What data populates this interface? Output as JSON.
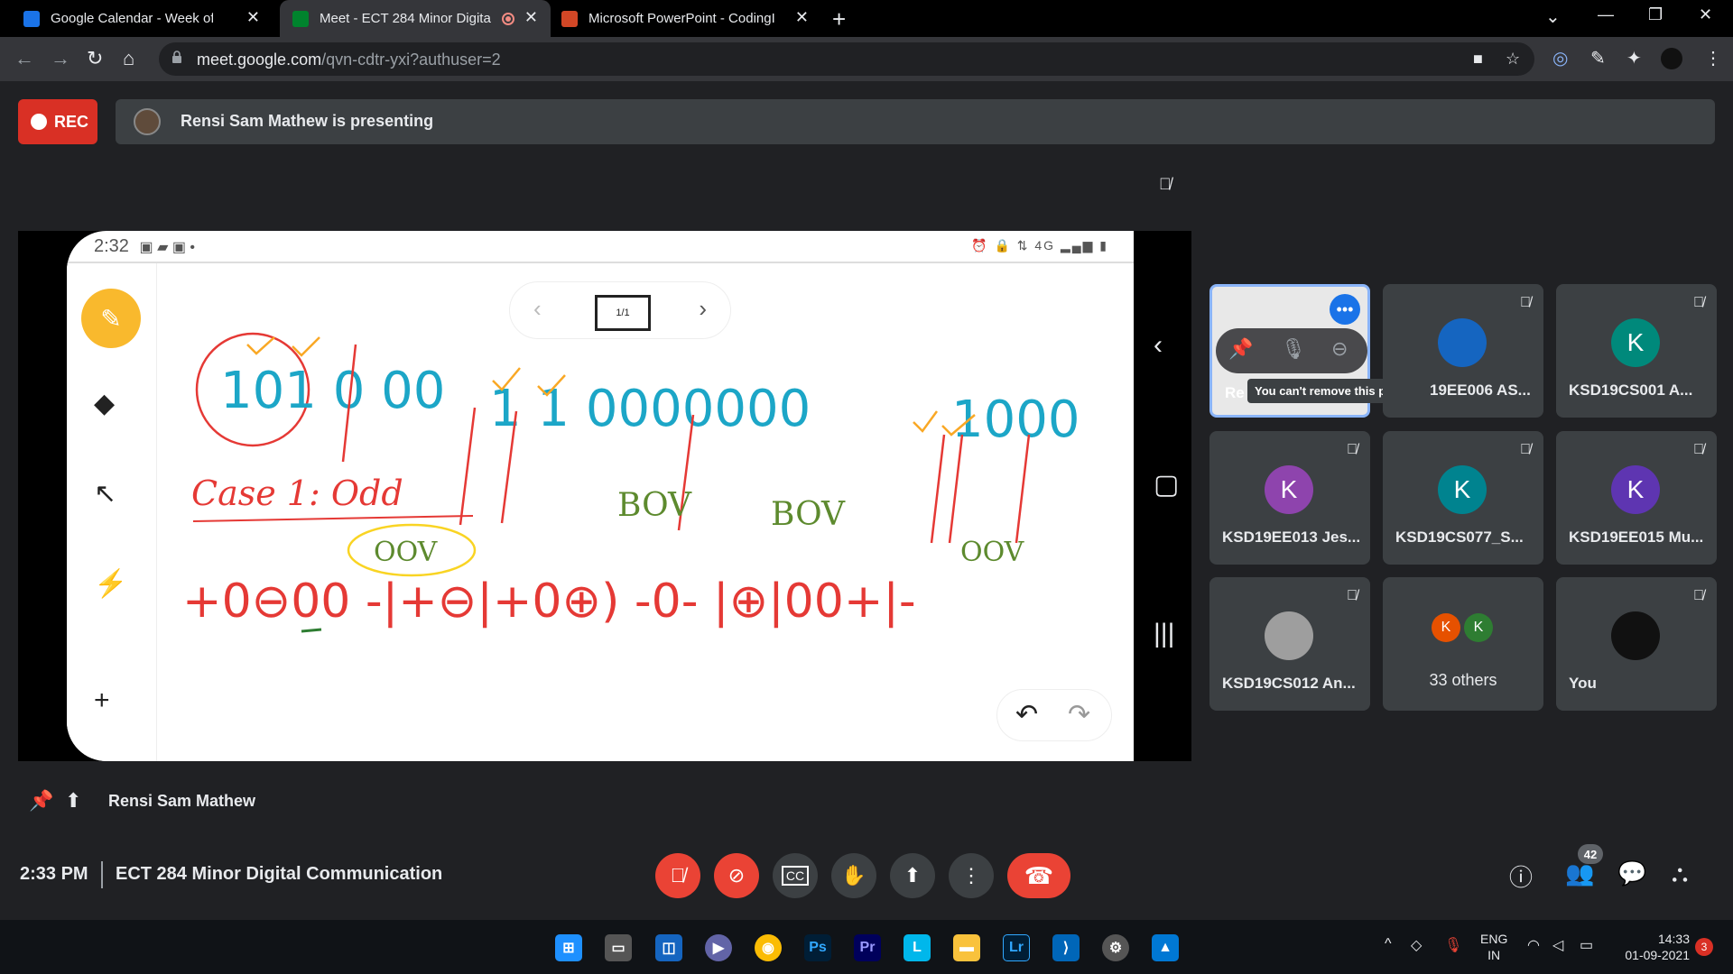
{
  "browser": {
    "tabs": [
      {
        "title": "Google Calendar - Week of Augu",
        "fav_color": "#1a73e8"
      },
      {
        "title": "Meet - ECT 284 Minor Digita",
        "fav_color": "#00832d"
      },
      {
        "title": "Microsoft PowerPoint - CodingI",
        "fav_color": "#d24726"
      }
    ],
    "url_host": "meet.google.com",
    "url_path": "/qvn-cdtr-yxi?authuser=2"
  },
  "meet": {
    "rec_label": "REC",
    "presenting_text": "Rensi Sam Mathew is presenting",
    "presenter_name": "Rensi Sam Mathew",
    "time": "2:33 PM",
    "meeting_name": "ECT 284 Minor Digital Communication",
    "participant_count": "42",
    "tooltip": "You can't remove this participant"
  },
  "shared_screen": {
    "phone_time": "2:32",
    "page_indicator": "1/1",
    "whiteboard_lines": [
      "101 0 00 1 1 0000000 1 000 1",
      "Case 1: Odd",
      "BOV BOV OOV",
      "+0⊖00 -|+⊖|+0⊕) -0- |⊕|00+|-"
    ]
  },
  "tiles": [
    {
      "name": "Re",
      "initial": "",
      "color": "#e8e8e8",
      "pinned": true
    },
    {
      "name": "19EE006 AS...",
      "initial": "",
      "color": "#1565c0"
    },
    {
      "name": "KSD19CS001 A...",
      "initial": "K",
      "color": "#00897b"
    },
    {
      "name": "KSD19EE013 Jes...",
      "initial": "K",
      "color": "#8e44ad"
    },
    {
      "name": "KSD19CS077_S...",
      "initial": "K",
      "color": "#00838f"
    },
    {
      "name": "KSD19EE015 Mu...",
      "initial": "K",
      "color": "#5e35b1"
    },
    {
      "name": "KSD19CS012 An...",
      "initial": "",
      "color": "#9e9e9e"
    },
    {
      "name": "33 others",
      "initial": "K",
      "color": "#e65100"
    },
    {
      "name": "You",
      "initial": "",
      "color": "#111111"
    }
  ],
  "taskbar": {
    "lang_1": "ENG",
    "lang_2": "IN",
    "clock_time": "14:33",
    "clock_date": "01-09-2021",
    "notif_count": "3",
    "apps": [
      "windows-start",
      "task-view",
      "widgets",
      "teams-chat",
      "chrome",
      "photoshop",
      "premiere",
      "lens",
      "file-explorer",
      "lightroom",
      "vscode",
      "settings",
      "photos"
    ]
  }
}
